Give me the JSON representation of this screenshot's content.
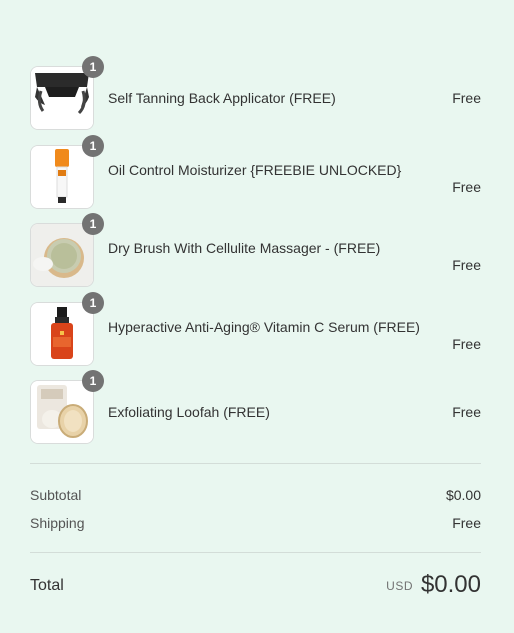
{
  "items": [
    {
      "name": "Self Tanning Back Applicator (FREE)",
      "price": "Free",
      "quantity": "1",
      "icon": "back-applicator-image"
    },
    {
      "name": "Oil Control Moisturizer {FREEBIE UNLOCKED}",
      "price": "Free",
      "quantity": "1",
      "icon": "moisturizer-tube-image"
    },
    {
      "name": "Dry Brush With Cellulite Massager - (FREE)",
      "price": "Free",
      "quantity": "1",
      "icon": "dry-brush-image"
    },
    {
      "name": "Hyperactive Anti-Aging® Vitamin C Serum (FREE)",
      "price": "Free",
      "quantity": "1",
      "icon": "serum-bottle-image"
    },
    {
      "name": "Exfoliating Loofah (FREE)",
      "price": "Free",
      "quantity": "1",
      "icon": "loofah-image"
    }
  ],
  "summary": {
    "subtotal_label": "Subtotal",
    "subtotal_value": "$0.00",
    "shipping_label": "Shipping",
    "shipping_value": "Free",
    "total_label": "Total",
    "currency": "USD",
    "total_value": "$0.00"
  },
  "colors": {
    "background": "#e9f7f0",
    "badge": "#737373",
    "text": "#333333"
  }
}
